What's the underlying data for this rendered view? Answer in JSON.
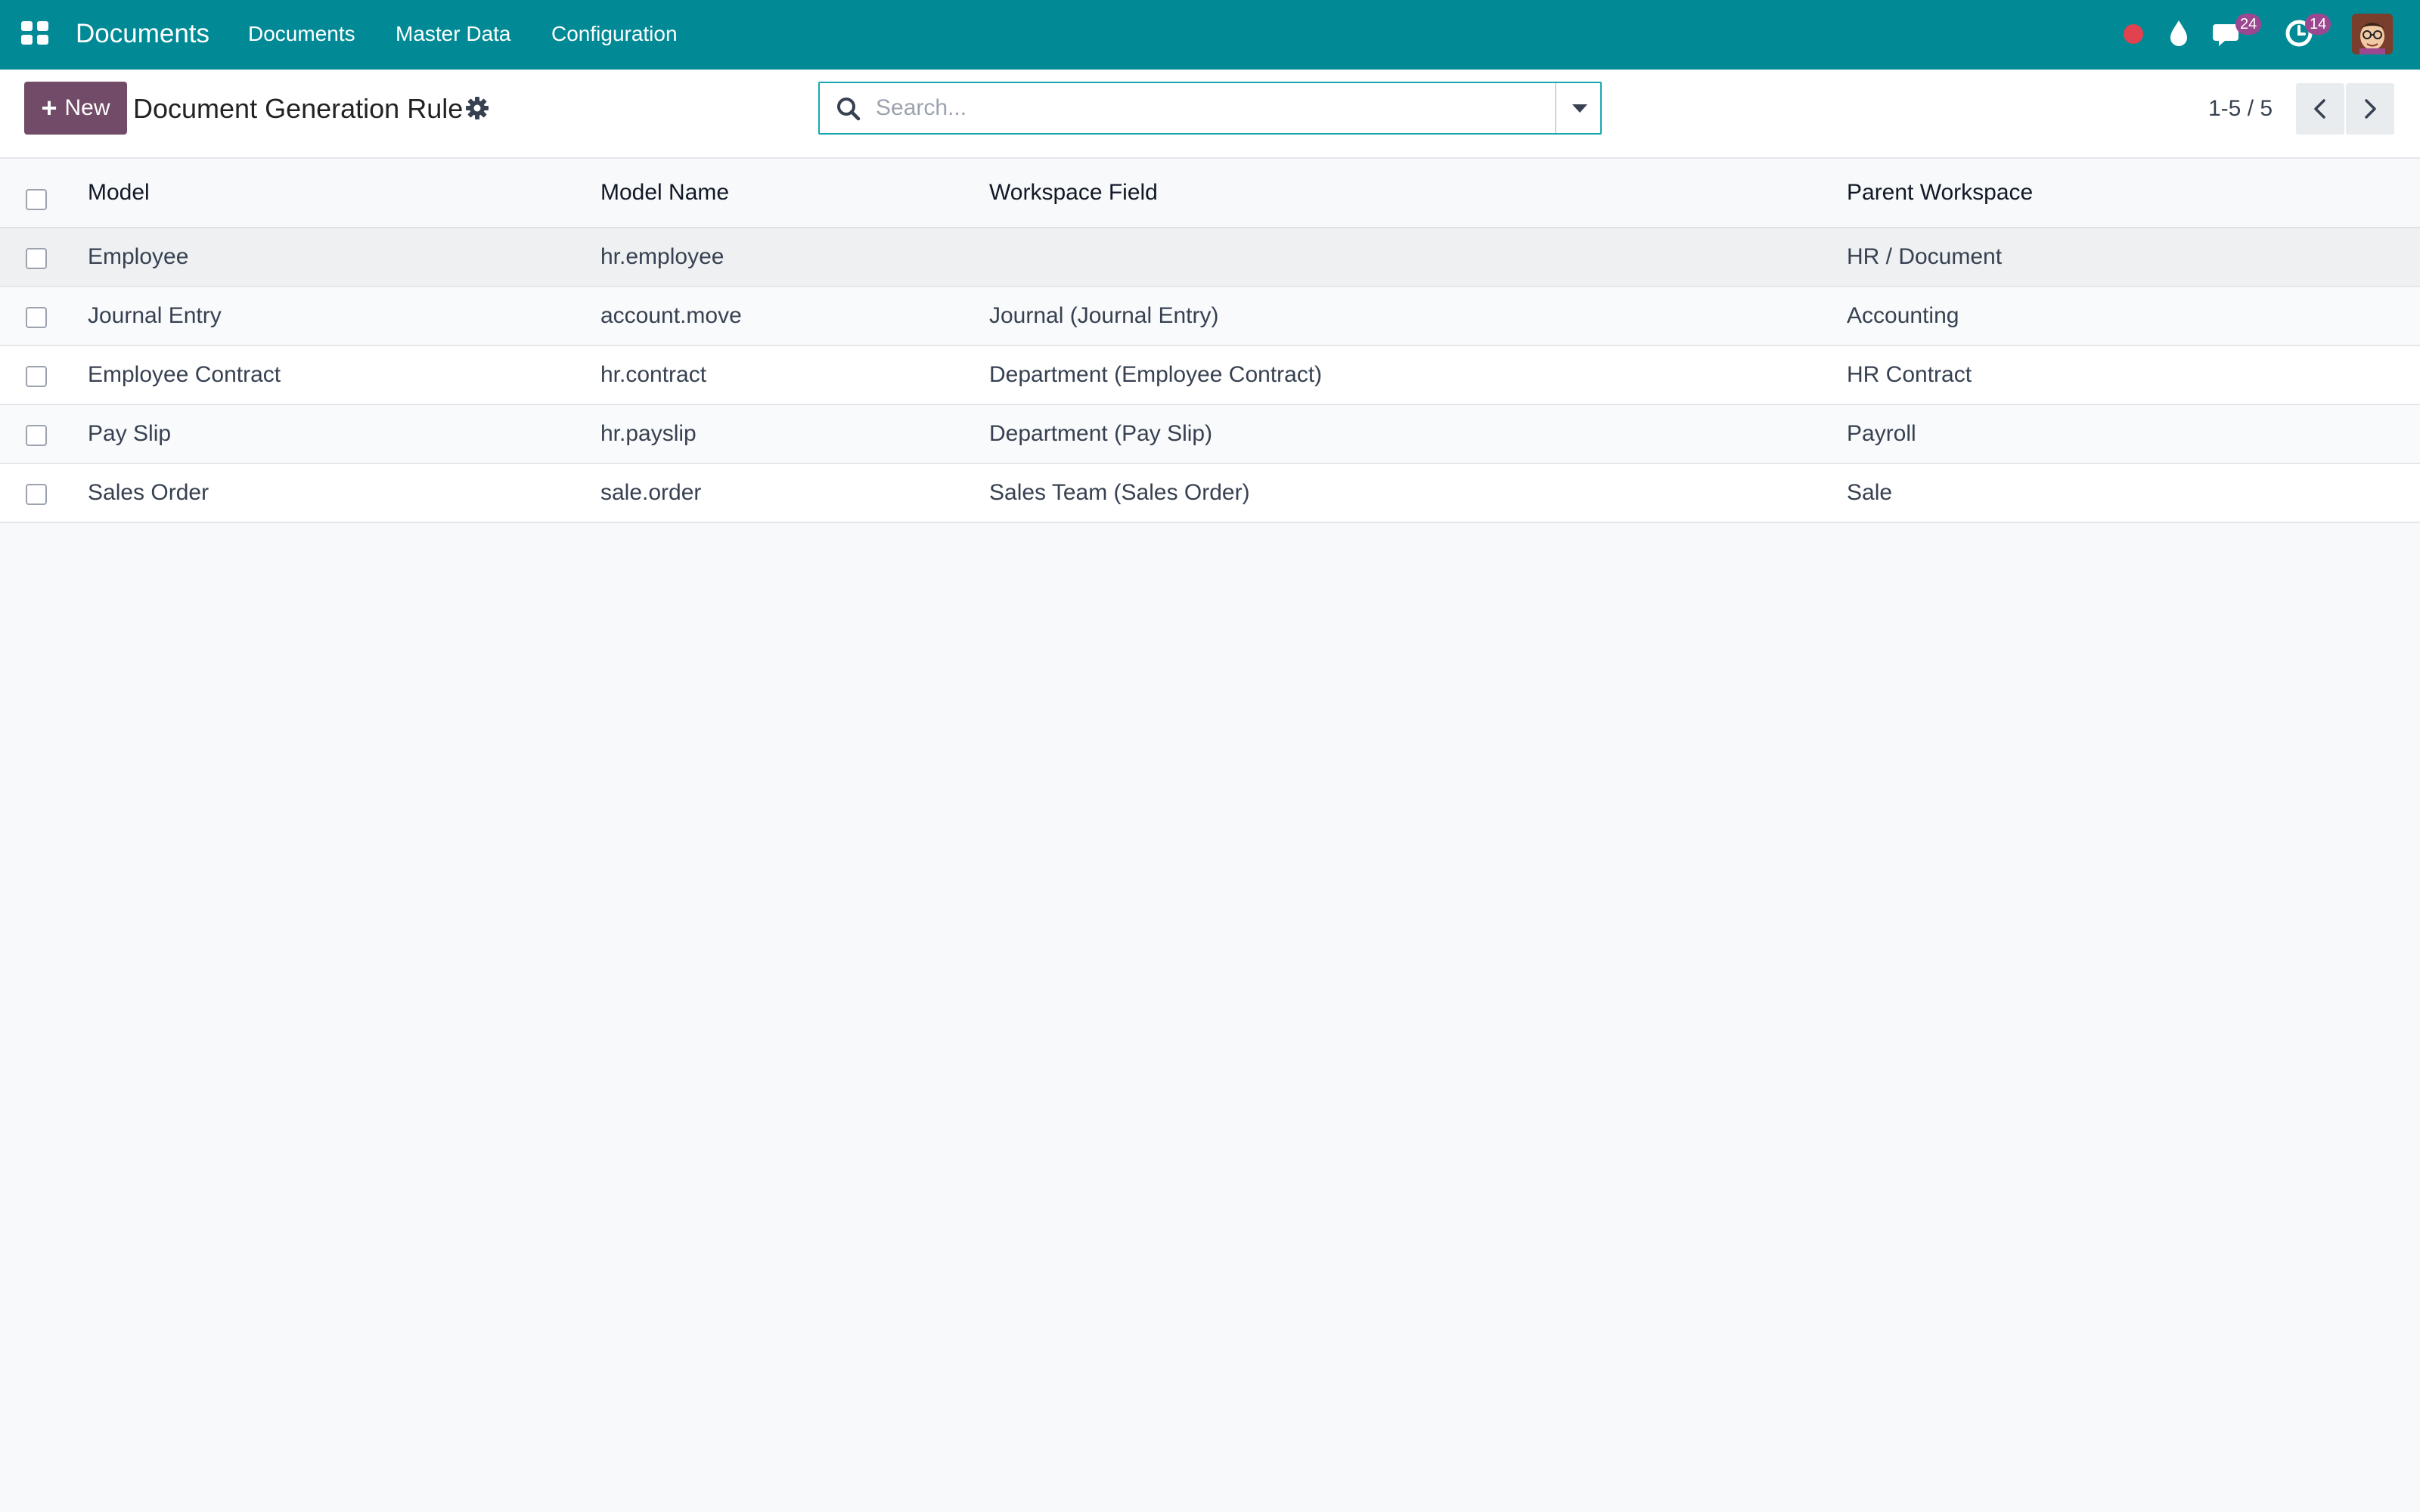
{
  "navbar": {
    "app_name": "Documents",
    "menu": [
      "Documents",
      "Master Data",
      "Configuration"
    ],
    "badges": {
      "messages": "24",
      "activities": "14"
    }
  },
  "control_panel": {
    "new_label": "New",
    "title": "Document Generation Rule",
    "search_placeholder": "Search...",
    "pager": "1-5 / 5"
  },
  "table": {
    "columns": [
      "Model",
      "Model Name",
      "Workspace Field",
      "Parent Workspace"
    ],
    "rows": [
      {
        "model": "Employee",
        "model_name": "hr.employee",
        "workspace_field": "",
        "parent_workspace": "HR / Document"
      },
      {
        "model": "Journal Entry",
        "model_name": "account.move",
        "workspace_field": "Journal (Journal Entry)",
        "parent_workspace": "Accounting"
      },
      {
        "model": "Employee Contract",
        "model_name": "hr.contract",
        "workspace_field": "Department (Employee Contract)",
        "parent_workspace": "HR Contract"
      },
      {
        "model": "Pay Slip",
        "model_name": "hr.payslip",
        "workspace_field": "Department (Pay Slip)",
        "parent_workspace": "Payroll"
      },
      {
        "model": "Sales Order",
        "model_name": "sale.order",
        "workspace_field": "Sales Team (Sales Order)",
        "parent_workspace": "Sale"
      }
    ]
  },
  "colors": {
    "navbar": "#018a96",
    "primary_button": "#714b67",
    "badge": "#9c4891",
    "record_dot": "#e0424f"
  },
  "icons": [
    "apps-grid-icon",
    "record-dot-icon",
    "drop-icon",
    "chat-icon",
    "clock-icon",
    "gear-icon",
    "search-icon",
    "caret-down-icon",
    "chevron-left-icon",
    "chevron-right-icon"
  ]
}
